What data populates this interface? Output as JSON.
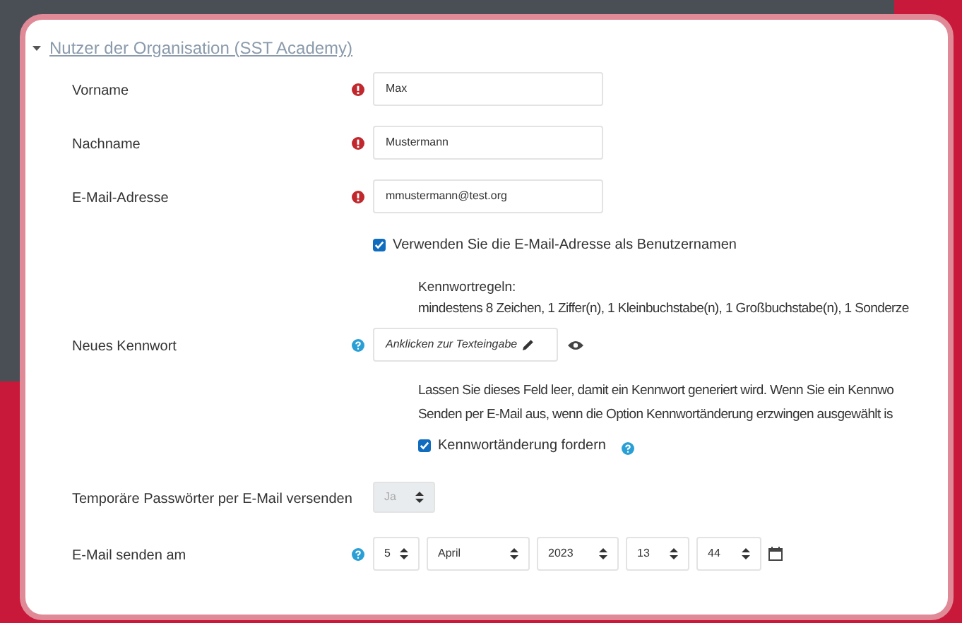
{
  "section": {
    "title": "Nutzer der Organisation (SST Academy)",
    "expanded": true
  },
  "fields": [
    {
      "label": "Vorname",
      "value": "Max",
      "required": true
    },
    {
      "label": "Nachname",
      "value": "Mustermann",
      "required": true
    },
    {
      "label": "E-Mail-Adresse",
      "value": "mmustermann@test.org",
      "required": true
    }
  ],
  "use_email_checkbox": {
    "label": "Verwenden Sie die E-Mail-Adresse als Benutzernamen",
    "checked": true
  },
  "password_rules": {
    "heading": "Kennwortregeln:",
    "text": "mindestens 8 Zeichen, 1 Ziffer(n), 1 Kleinbuchstabe(n), 1 Großbuchstabe(n), 1 Sonderze"
  },
  "new_password": {
    "label": "Neues Kennwort",
    "placeholder": "Anklicken zur Texteingabe"
  },
  "password_hint": [
    "Lassen Sie dieses Feld leer, damit ein Kennwort generiert wird. Wenn Sie ein Kennwo",
    "Senden per E-Mail aus, wenn die Option Kennwortänderung erzwingen ausgewählt is"
  ],
  "force_change_checkbox": {
    "label": "Kennwortänderung fordern",
    "checked": true
  },
  "temp_passwords": {
    "label": "Temporäre Passwörter per E-Mail versenden",
    "value": "Ja",
    "disabled": true
  },
  "send_date": {
    "label": "E-Mail senden am",
    "parts": [
      "5",
      "April",
      "2023",
      "13",
      "44"
    ]
  }
}
